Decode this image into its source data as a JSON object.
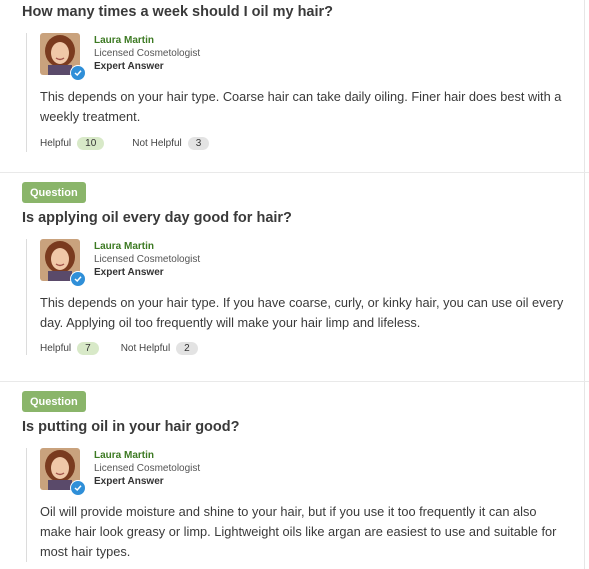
{
  "qa": [
    {
      "badge": "",
      "question": "How many times a week should I oil my hair?",
      "expert": {
        "name": "Laura Martin",
        "role": "Licensed Cosmetologist",
        "tag": "Expert Answer"
      },
      "answer": "This depends on your hair type. Coarse hair can take daily oiling. Finer hair does best with a weekly treatment.",
      "helpful_label": "Helpful",
      "helpful_count": "10",
      "not_helpful_label": "Not Helpful",
      "not_helpful_count": "3"
    },
    {
      "badge": "Question",
      "question": "Is applying oil every day good for hair?",
      "expert": {
        "name": "Laura Martin",
        "role": "Licensed Cosmetologist",
        "tag": "Expert Answer"
      },
      "answer": "This depends on your hair type. If you have coarse, curly, or kinky hair, you can use oil every day. Applying oil too frequently will make your hair limp and lifeless.",
      "helpful_label": "Helpful",
      "helpful_count": "7",
      "not_helpful_label": "Not Helpful",
      "not_helpful_count": "2"
    },
    {
      "badge": "Question",
      "question": "Is putting oil in your hair good?",
      "expert": {
        "name": "Laura Martin",
        "role": "Licensed Cosmetologist",
        "tag": "Expert Answer"
      },
      "answer": "Oil will provide moisture and shine to your hair, but if you use it too frequently it can also make hair look greasy or limp. Lightweight oils like argan are easiest to use and suitable for most hair types."
    }
  ],
  "icons": {
    "verified": "verified-check-icon",
    "avatar": "expert-avatar"
  },
  "colors": {
    "badge": "#8ab56a",
    "name": "#3d7a23",
    "helpful_pill": "#d8e9c8",
    "not_helpful_pill": "#e3e3e3",
    "verified": "#2f8fd8"
  }
}
